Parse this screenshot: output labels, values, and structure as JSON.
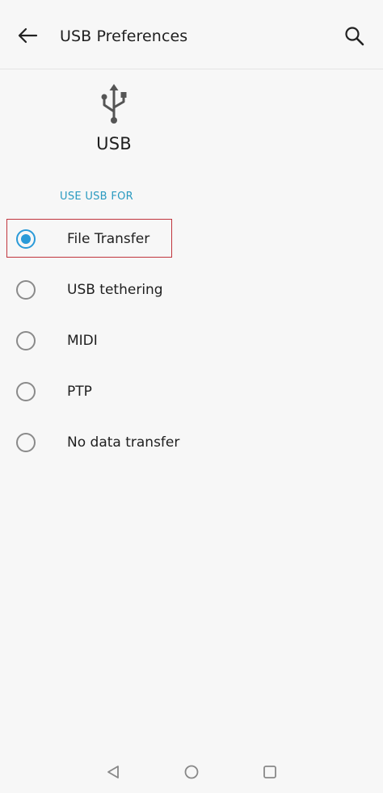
{
  "appbar": {
    "title": "USB Preferences",
    "back_icon": "arrow-left-icon",
    "search_icon": "search-icon"
  },
  "header": {
    "icon": "usb-icon",
    "title": "USB"
  },
  "section": {
    "label": "USE USB FOR"
  },
  "options": [
    {
      "label": "File Transfer",
      "selected": true
    },
    {
      "label": "USB tethering",
      "selected": false
    },
    {
      "label": "MIDI",
      "selected": false
    },
    {
      "label": "PTP",
      "selected": false
    },
    {
      "label": "No data transfer",
      "selected": false
    }
  ],
  "navbar": {
    "back_icon": "triangle-back-icon",
    "home_icon": "circle-home-icon",
    "recents_icon": "square-recents-icon"
  },
  "colors": {
    "accent": "#2a9ad8",
    "section_label": "#2a9ac0",
    "highlight_border": "#c0353d",
    "background": "#f7f7f7"
  }
}
